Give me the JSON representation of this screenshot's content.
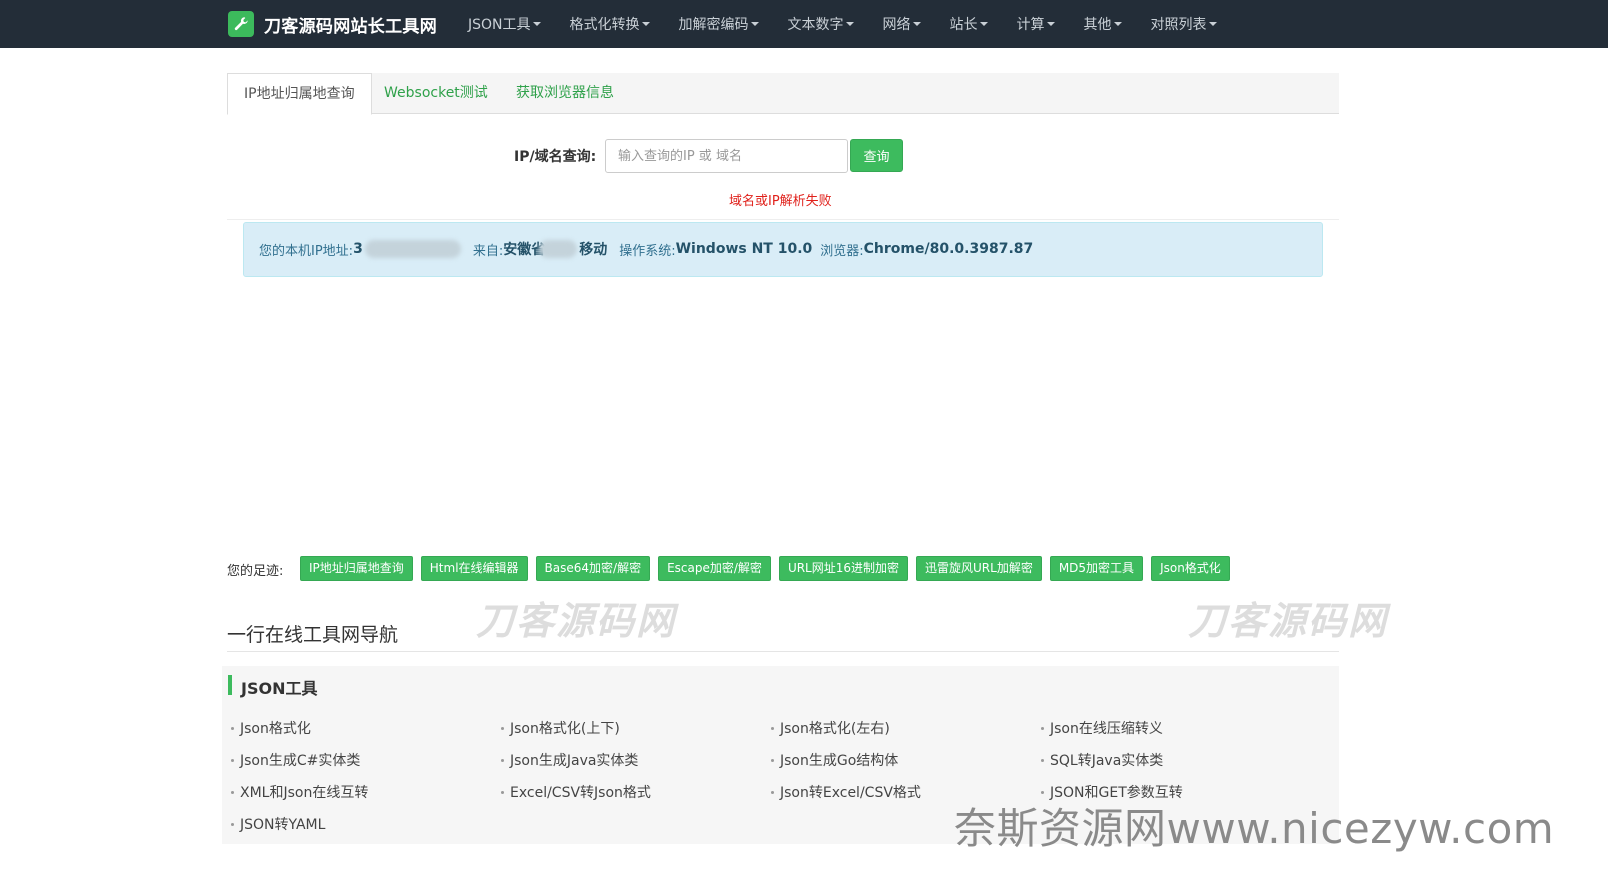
{
  "navbar": {
    "brand": "刀客源码网站长工具网",
    "menu": [
      {
        "label": "JSON工具"
      },
      {
        "label": "格式化转换"
      },
      {
        "label": "加解密编码"
      },
      {
        "label": "文本数字"
      },
      {
        "label": "网络"
      },
      {
        "label": "站长"
      },
      {
        "label": "计算"
      },
      {
        "label": "其他"
      },
      {
        "label": "对照列表"
      }
    ]
  },
  "tabs": [
    {
      "label": "IP地址归属地查询",
      "active": true
    },
    {
      "label": "Websocket测试",
      "active": false
    },
    {
      "label": "获取浏览器信息",
      "active": false
    }
  ],
  "query": {
    "label": "IP/域名查询:",
    "placeholder": "输入查询的IP 或 域名",
    "value": "",
    "button": "查询",
    "error": "域名或IP解析失败"
  },
  "info": {
    "ip_label": "您的本机IP地址:",
    "ip_value": "3",
    "from_label": "来自:",
    "from_province": "安徽省",
    "from_isp": "移动",
    "os_label": "操作系统:",
    "os_value": "Windows NT 10.0",
    "browser_label": "浏览器:",
    "browser_value": "Chrome/80.0.3987.87"
  },
  "footprints": {
    "label": "您的足迹:",
    "items": [
      "IP地址归属地查询",
      "Html在线编辑器",
      "Base64加密/解密",
      "Escape加密/解密",
      "URL网址16进制加密",
      "迅雷旋风URL加解密",
      "MD5加密工具",
      "Json格式化"
    ]
  },
  "watermarks": [
    "刀客源码网",
    "刀客源码网"
  ],
  "nav_section": {
    "title": "一行在线工具网导航",
    "category": "JSON工具",
    "tools": [
      "Json格式化",
      "Json格式化(上下)",
      "Json格式化(左右)",
      "Json在线压缩转义",
      "Json生成C#实体类",
      "Json生成Java实体类",
      "Json生成Go结构体",
      "SQL转Java实体类",
      "XML和Json在线互转",
      "Excel/CSV转Json格式",
      "Json转Excel/CSV格式",
      "JSON和GET参数互转",
      "JSON转YAML"
    ]
  },
  "corner_watermark": "奈斯资源网www.nicezyw.com",
  "colors": {
    "navbar_bg": "#232d38",
    "accent_green": "#3dbb5e",
    "error_red": "#e0211b",
    "info_bg": "#d9edf7"
  }
}
